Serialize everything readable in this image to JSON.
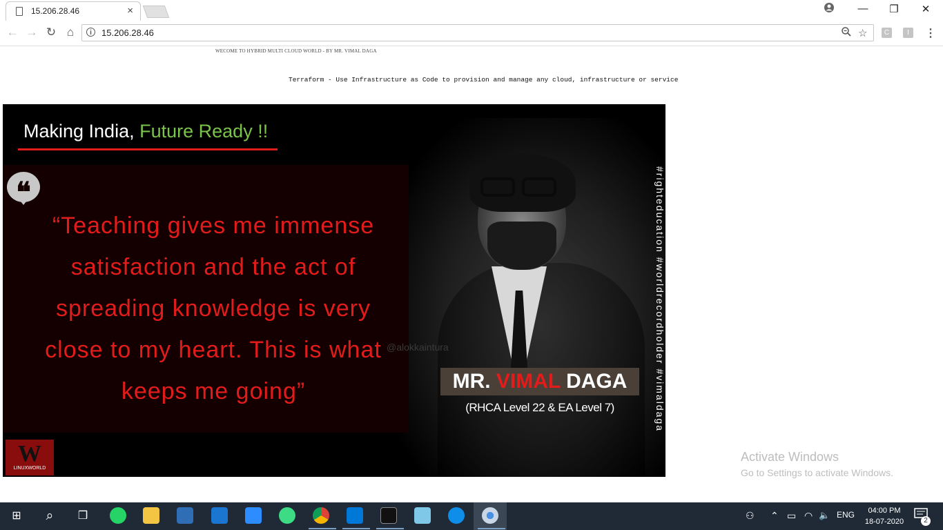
{
  "browser": {
    "tab_title": "15.206.28.46",
    "url": "15.206.28.46",
    "window_controls": {
      "minimize": "—",
      "restore": "❐",
      "close": "✕"
    },
    "nav": {
      "back": "←",
      "forward": "→",
      "reload": "↻",
      "home": "⌂"
    },
    "omnibox_icons": {
      "zoom": "zoom-icon",
      "star": "star-icon"
    },
    "extensions": [
      "C",
      "I"
    ],
    "menu": "⋮"
  },
  "page": {
    "welcome_text": "WECOME TO HYBRID MULTI CLOUD WORLD - BY MR. VIMAL DAGA",
    "subtitle_text": "Terraform - Use Infrastructure as Code to provision and manage any cloud, infrastructure or service",
    "banner": {
      "headline_part1": "Making India,",
      "headline_part2": "Future Ready !!",
      "quote_mark": "❝",
      "quote": "“Teaching gives me immense satisfaction and the act of spreading knowledge is very close to my heart. This is what keeps me going”",
      "watermark": "@alokkaintura",
      "name_prefix": "MR.",
      "name_first": "VIMAL",
      "name_last": "DAGA",
      "credentials": "(RHCA Level 22 & EA Level 7)",
      "hashtags": "#righteducation #worldrecordholder #vimaldaga",
      "logo_letter": "W",
      "logo_text": "LINUXWORLD",
      "colors": {
        "accent_red": "#e21b1b",
        "accent_green": "#7bc34a"
      }
    },
    "activation": {
      "title": "Activate Windows",
      "subtitle": "Go to Settings to activate Windows."
    }
  },
  "taskbar": {
    "start": "⊞",
    "search": "⌕",
    "task_view": "❒",
    "apps": [
      "whatsapp-icon",
      "file-explorer-icon",
      "virtualbox-icon",
      "mail-icon",
      "zoom-icon",
      "android-icon",
      "chrome-icon",
      "vscode-icon",
      "terminal-icon",
      "notepad-icon",
      "teamviewer-icon",
      "chrome-active-icon"
    ],
    "tray": {
      "people": "⚇",
      "chevron": "⌃",
      "battery": "▭",
      "wifi": "◠",
      "volume": "🔈",
      "language": "ENG"
    },
    "time": "04:00 PM",
    "date": "18-07-2020",
    "notifications": "2"
  }
}
